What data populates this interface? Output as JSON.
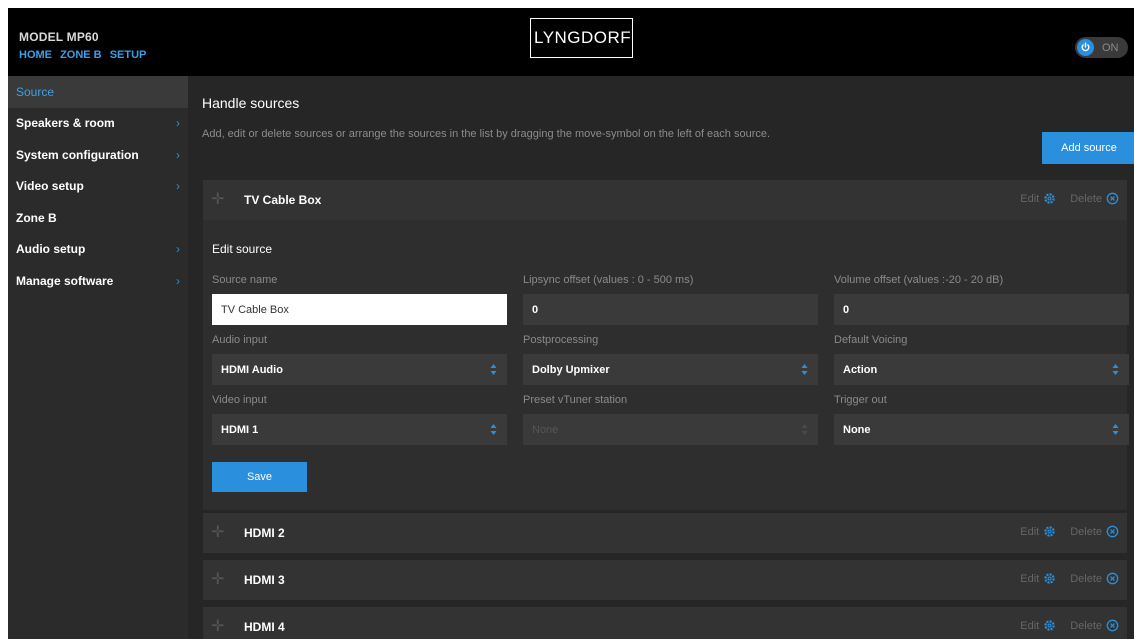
{
  "header": {
    "model": "MODEL MP60",
    "nav": [
      "HOME",
      "ZONE B",
      "SETUP"
    ],
    "logo": "LYNGDORF",
    "power_label": "ON"
  },
  "sidebar": {
    "items": [
      {
        "label": "Source",
        "active": true,
        "chevron": false
      },
      {
        "label": "Speakers & room",
        "active": false,
        "chevron": true
      },
      {
        "label": "System configuration",
        "active": false,
        "chevron": true
      },
      {
        "label": "Video setup",
        "active": false,
        "chevron": true
      },
      {
        "label": "Zone B",
        "active": false,
        "chevron": false
      },
      {
        "label": "Audio setup",
        "active": false,
        "chevron": true
      },
      {
        "label": "Manage software",
        "active": false,
        "chevron": true
      }
    ]
  },
  "main": {
    "title": "Handle sources",
    "description": "Add, edit or delete sources or arrange the sources in the list by dragging the move-symbol on the left of each source.",
    "add_button": "Add source",
    "edit_label": "Edit",
    "delete_label": "Delete",
    "sources": [
      "TV Cable Box",
      "HDMI 2",
      "HDMI 3",
      "HDMI 4"
    ],
    "edit_panel": {
      "title": "Edit source",
      "fields": {
        "source_name": {
          "label": "Source name",
          "value": "TV Cable Box"
        },
        "lipsync": {
          "label": "Lipsync offset (values : 0 - 500 ms)",
          "value": "0"
        },
        "volume": {
          "label": "Volume offset (values :-20 - 20 dB)",
          "value": "0"
        },
        "audio_input": {
          "label": "Audio input",
          "value": "HDMI Audio"
        },
        "postprocessing": {
          "label": "Postprocessing",
          "value": "Dolby Upmixer"
        },
        "voicing": {
          "label": "Default Voicing",
          "value": "Action"
        },
        "video_input": {
          "label": "Video input",
          "value": "HDMI 1"
        },
        "vtuner": {
          "label": "Preset vTuner station",
          "value": "None"
        },
        "trigger": {
          "label": "Trigger out",
          "value": "None"
        }
      },
      "save_label": "Save"
    }
  },
  "colors": {
    "accent": "#2a8fdc",
    "background": "#262626",
    "header": "#000000",
    "sidebar": "#2b2b2b"
  }
}
